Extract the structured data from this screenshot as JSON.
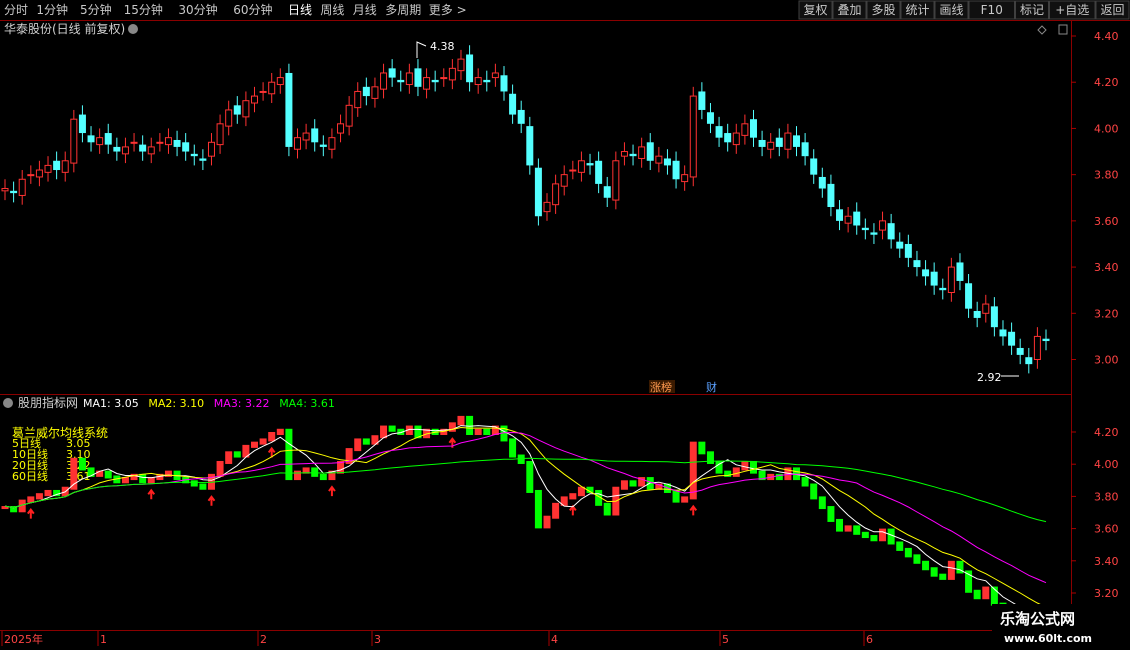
{
  "toolbar": {
    "periods": [
      "分时",
      "1分钟",
      "5分钟",
      "15分钟",
      "30分钟",
      "60分钟",
      "日线",
      "周线",
      "月线",
      "多周期",
      "更多 >"
    ],
    "active_period": "日线",
    "right_buttons": [
      "复权",
      "叠加",
      "多股",
      "统计",
      "画线",
      "F10",
      "标记",
      "+自选",
      "返回"
    ]
  },
  "colors": {
    "up": "#ff3232",
    "down": "#54ffff",
    "bg": "#000000",
    "grid": "#7a0000",
    "ma1": "#ffffff",
    "ma2": "#ffff00",
    "ma3": "#ff00ff",
    "ma4": "#00ff00",
    "green_bar": "#00ff00",
    "axis_text": "#ff4444"
  },
  "main_chart": {
    "title": "华泰股份(日线 前复权)",
    "high_label": "4.38",
    "low_label": "2.92",
    "y_ticks": [
      "4.40",
      "4.20",
      "4.00",
      "3.80",
      "3.60",
      "3.40",
      "3.20",
      "3.00"
    ],
    "markers": {
      "zhangbang": "涨榜",
      "cai": "财"
    }
  },
  "indicator": {
    "name": "股朋指标网",
    "ma_labels": [
      {
        "label": "MA1: 3.05"
      },
      {
        "label": "MA2: 3.10"
      },
      {
        "label": "MA3: 3.22"
      },
      {
        "label": "MA4: 3.61"
      }
    ],
    "system_title": "葛兰威尔均线系统",
    "legend": [
      {
        "name": "5日线",
        "value": "3.05"
      },
      {
        "name": "10日线",
        "value": "3.10"
      },
      {
        "name": "20日线",
        "value": "3.22"
      },
      {
        "name": "60日线",
        "value": "3.61"
      }
    ],
    "y_ticks": [
      "4.20",
      "4.00",
      "3.80",
      "3.60",
      "3.40",
      "3.20"
    ]
  },
  "x_axis": {
    "labels": [
      "2025年",
      "1",
      "2",
      "3",
      "4",
      "5",
      "6"
    ]
  },
  "watermark": {
    "line1": "乐淘公式网",
    "line2": "www.60lt.com"
  },
  "chart_data": {
    "type": "candlestick",
    "y_range": [
      2.92,
      4.4
    ],
    "closes": [
      3.74,
      3.72,
      3.78,
      3.8,
      3.82,
      3.84,
      3.82,
      3.86,
      4.04,
      3.98,
      3.94,
      3.96,
      3.93,
      3.9,
      3.92,
      3.94,
      3.9,
      3.92,
      3.94,
      3.96,
      3.92,
      3.9,
      3.88,
      3.86,
      3.94,
      4.02,
      4.08,
      4.06,
      4.12,
      4.14,
      4.16,
      4.2,
      4.22,
      3.92,
      3.96,
      3.98,
      3.94,
      3.92,
      3.96,
      4.02,
      4.1,
      4.16,
      4.14,
      4.18,
      4.24,
      4.22,
      4.2,
      4.24,
      4.18,
      4.22,
      4.2,
      4.22,
      4.26,
      4.3,
      4.2,
      4.22,
      4.2,
      4.24,
      4.16,
      4.06,
      4.02,
      3.84,
      3.62,
      3.68,
      3.76,
      3.8,
      3.82,
      3.86,
      3.84,
      3.76,
      3.7,
      3.86,
      3.9,
      3.88,
      3.92,
      3.86,
      3.88,
      3.84,
      3.78,
      3.8,
      4.14,
      4.08,
      4.02,
      3.96,
      3.94,
      3.98,
      4.02,
      3.96,
      3.92,
      3.94,
      3.92,
      3.98,
      3.92,
      3.88,
      3.8,
      3.74,
      3.66,
      3.6,
      3.62,
      3.58,
      3.56,
      3.54,
      3.6,
      3.52,
      3.48,
      3.44,
      3.4,
      3.36,
      3.32,
      3.3,
      3.4,
      3.34,
      3.22,
      3.18,
      3.24,
      3.14,
      3.1,
      3.06,
      3.02,
      2.98,
      3.1,
      3.08
    ],
    "ma_series": [
      {
        "values": [
          3.05
        ]
      },
      {
        "values": [
          3.1
        ]
      },
      {
        "values": [
          3.22
        ]
      },
      {
        "values": [
          3.61
        ]
      }
    ]
  }
}
